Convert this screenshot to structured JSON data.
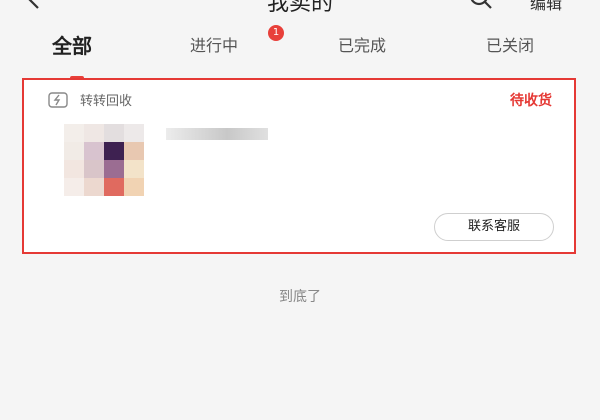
{
  "header": {
    "title": "我卖的",
    "edit_label": "编辑",
    "back_icon": "chevron-left-icon",
    "search_icon": "search-icon"
  },
  "tabs": [
    {
      "label": "全部",
      "active": true
    },
    {
      "label": "进行中",
      "badge": "1"
    },
    {
      "label": "已完成"
    },
    {
      "label": "已关闭"
    }
  ],
  "order": {
    "store_icon": "recycle-icon",
    "store_name": "转转回收",
    "status": "待收货",
    "contact_button": "联系客服"
  },
  "footer": {
    "end_text": "到底了"
  },
  "colors": {
    "accent": "#e53935",
    "background": "#f5f5f5"
  }
}
